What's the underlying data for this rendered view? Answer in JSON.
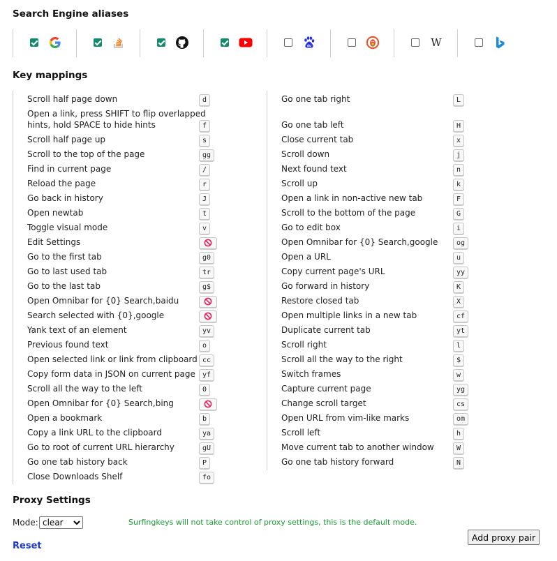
{
  "sections": {
    "search_engines_title": "Search Engine aliases",
    "key_mappings_title": "Key mappings",
    "proxy_title": "Proxy Settings"
  },
  "engines": [
    {
      "name": "google",
      "icon": "google-icon",
      "checked": true
    },
    {
      "name": "stackoverflow",
      "icon": "stackoverflow-icon",
      "checked": true
    },
    {
      "name": "github",
      "icon": "github-icon",
      "checked": true
    },
    {
      "name": "youtube",
      "icon": "youtube-icon",
      "checked": true
    },
    {
      "name": "baidu",
      "icon": "baidu-icon",
      "checked": false
    },
    {
      "name": "duckduckgo",
      "icon": "duckduckgo-icon",
      "checked": false
    },
    {
      "name": "wikipedia",
      "icon": "wikipedia-icon",
      "checked": false
    },
    {
      "name": "bing",
      "icon": "bing-icon",
      "checked": false
    }
  ],
  "mappings_left": [
    {
      "label": "Scroll half page down",
      "key": "d"
    },
    {
      "label": "Open a link, press SHIFT to flip overlapped",
      "label2": "hints, hold SPACE to hide hints",
      "key": "f"
    },
    {
      "label": "Scroll half page up",
      "key": "s"
    },
    {
      "label": "Scroll to the top of the page",
      "key": "gg"
    },
    {
      "label": "Find in current page",
      "key": "/"
    },
    {
      "label": "Reload the page",
      "key": "r"
    },
    {
      "label": "Go back in history",
      "key": "J"
    },
    {
      "label": "Open newtab",
      "key": "t"
    },
    {
      "label": "Toggle visual mode",
      "key": "v"
    },
    {
      "label": "Edit Settings",
      "key": null
    },
    {
      "label": "Go to the first tab",
      "key": "g0"
    },
    {
      "label": "Go to last used tab",
      "key": "tr"
    },
    {
      "label": "Go to the last tab",
      "key": "g$"
    },
    {
      "label": "Open Omnibar for {0} Search,baidu",
      "key": null
    },
    {
      "label": "Search selected with {0},google",
      "key": null
    },
    {
      "label": "Yank text of an element",
      "key": "yv"
    },
    {
      "label": "Previous found text",
      "key": "o"
    },
    {
      "label": "Open selected link or link from clipboard",
      "key": "cc"
    },
    {
      "label": "Copy form data in JSON on current page",
      "key": "yf"
    },
    {
      "label": "Scroll all the way to the left",
      "key": "0"
    },
    {
      "label": "Open Omnibar for {0} Search,bing",
      "key": null
    },
    {
      "label": "Open a bookmark",
      "key": "b"
    },
    {
      "label": "Copy a link URL to the clipboard",
      "key": "ya"
    },
    {
      "label": "Go to root of current URL hierarchy",
      "key": "gU"
    },
    {
      "label": "Go one tab history back",
      "key": "P"
    },
    {
      "label": "Close Downloads Shelf",
      "key": "fo"
    }
  ],
  "mappings_right": [
    {
      "label": "Go one tab right",
      "key": "L"
    },
    {
      "label": "Go one tab left",
      "key": "H"
    },
    {
      "label": "Close current tab",
      "key": "x"
    },
    {
      "label": "Scroll down",
      "key": "j"
    },
    {
      "label": "Next found text",
      "key": "n"
    },
    {
      "label": "Scroll up",
      "key": "k"
    },
    {
      "label": "Open a link in non-active new tab",
      "key": "F"
    },
    {
      "label": "Scroll to the bottom of the page",
      "key": "G"
    },
    {
      "label": "Go to edit box",
      "key": "i"
    },
    {
      "label": "Open Omnibar for {0} Search,google",
      "key": "og"
    },
    {
      "label": "Open a URL",
      "key": "u"
    },
    {
      "label": "Copy current page's URL",
      "key": "yy"
    },
    {
      "label": "Go forward in history",
      "key": "K"
    },
    {
      "label": "Restore closed tab",
      "key": "X"
    },
    {
      "label": "Open multiple links in a new tab",
      "key": "cf"
    },
    {
      "label": "Duplicate current tab",
      "key": "yt"
    },
    {
      "label": "Scroll right",
      "key": "l"
    },
    {
      "label": "Scroll all the way to the right",
      "key": "$"
    },
    {
      "label": "Switch frames",
      "key": "w"
    },
    {
      "label": "Capture current page",
      "key": "yg"
    },
    {
      "label": "Change scroll target",
      "key": "cs"
    },
    {
      "label": "Open URL from vim-like marks",
      "key": "om"
    },
    {
      "label": "Scroll left",
      "key": "h"
    },
    {
      "label": "Move current tab to another window",
      "key": "W"
    },
    {
      "label": "Go one tab history forward",
      "key": "N"
    }
  ],
  "proxy": {
    "mode_label": "Mode:",
    "mode_value": "clear",
    "message": "Surfingkeys will not take control of proxy settings, this is the default mode.",
    "reset_label": "Reset",
    "add_pair_label": "Add proxy pair"
  },
  "colors": {
    "checkbox_on": "#158a6c",
    "message_green": "#1a9a32",
    "link_blue": "#1a39c9",
    "ban_red": "#e0245e"
  }
}
